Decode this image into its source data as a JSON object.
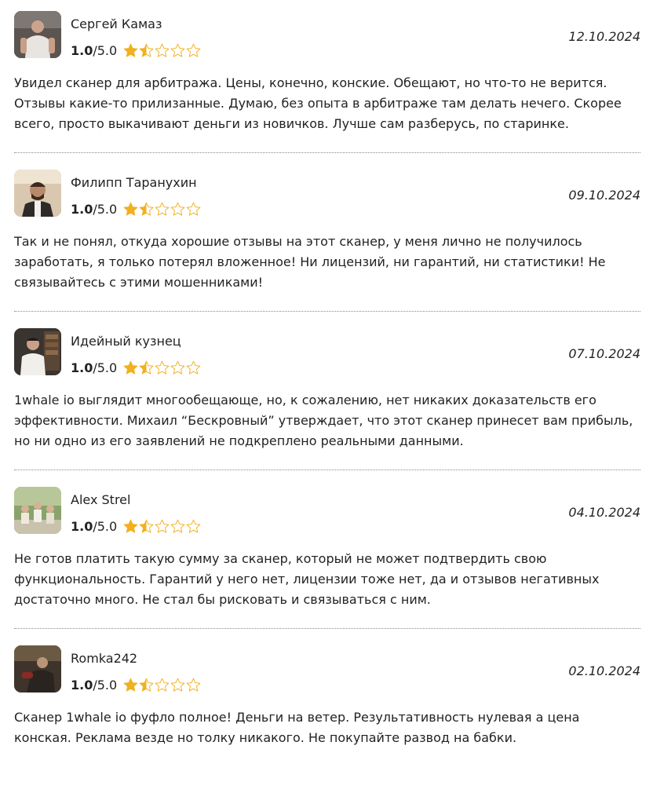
{
  "reviews": [
    {
      "author": "Сергей Камаз",
      "rating_value": "1.0",
      "rating_max": "/5.0",
      "rating": 1.5,
      "date": "12.10.2024",
      "text": "Увидел сканер для арбитража. Цены, конечно, конские. Обещают, но что-то не верится. Отзывы какие-то прилизанные. Думаю, без опыта в арбитраже там делать нечего. Скорее всего, просто выкачивают деньги из новичков. Лучше сам разберусь, по старинке."
    },
    {
      "author": "Филипп Таранухин",
      "rating_value": "1.0",
      "rating_max": "/5.0",
      "rating": 1.5,
      "date": "09.10.2024",
      "text": "Так и не понял, откуда хорошие отзывы на этот сканер, у меня лично не получилось заработать, я только потерял вложенное! Ни лицензий, ни гарантий, ни статистики! Не связывайтесь с этими мошенниками!"
    },
    {
      "author": "Идейный кузнец",
      "rating_value": "1.0",
      "rating_max": "/5.0",
      "rating": 1.5,
      "date": "07.10.2024",
      "text": "1whale io выглядит многообещающе, но, к сожалению, нет никаких доказательств его эффективности. Михаил “Бескровный” утверждает, что этот сканер принесет вам прибыль, но ни одно из его заявлений не подкреплено реальными данными."
    },
    {
      "author": "Alex Strel",
      "rating_value": "1.0",
      "rating_max": "/5.0",
      "rating": 1.5,
      "date": "04.10.2024",
      "text": "Не готов платить такую сумму за сканер, который не может подтвердить свою функциональность. Гарантий у него нет, лицензии тоже нет, да и отзывов негативных достаточно много. Не стал бы рисковать и связываться с ним."
    },
    {
      "author": "Romka242",
      "rating_value": "1.0",
      "rating_max": "/5.0",
      "rating": 1.5,
      "date": "02.10.2024",
      "text": "Сканер 1whale io фуфло полное! Деньги на ветер. Результативность нулевая а цена конская. Реклама везде но толку никакого. Не покупайте развод на бабки."
    }
  ],
  "colors": {
    "star_fill": "#f2b01e",
    "star_outline": "#f2b01e",
    "divider": "#8a8a8a",
    "text": "#222222"
  },
  "icons": {
    "star": "star-icon",
    "avatar": "avatar"
  }
}
